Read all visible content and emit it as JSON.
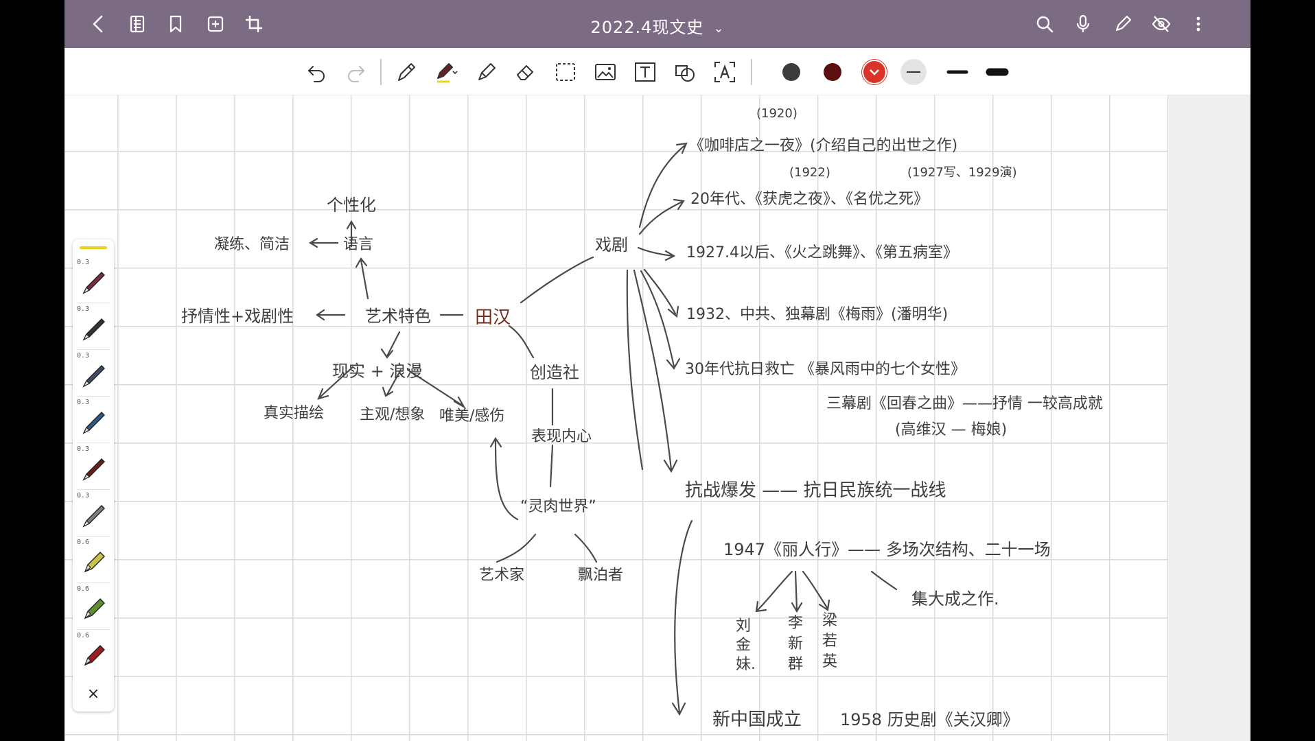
{
  "header": {
    "title": "2022.4现文史",
    "title_chevron": "⌄",
    "left_icons": [
      "back-icon",
      "pages-icon",
      "bookmark-icon",
      "add-page-icon",
      "crop-icon"
    ],
    "right_icons": [
      "search-icon",
      "microphone-icon",
      "pencil-icon",
      "hide-icon",
      "more-icon"
    ],
    "bar_color": "#7b6c84"
  },
  "toolbar": {
    "tools": [
      "undo-icon",
      "redo-icon",
      "pen-icon",
      "pen-active-icon",
      "highlighter-icon",
      "eraser-icon",
      "lasso-select-icon",
      "image-icon",
      "text-icon",
      "shape-icon",
      "text-recognition-icon"
    ],
    "colors": [
      "#3b3b3b",
      "#5c0f0f",
      "#d9332a"
    ],
    "line_widths": [
      "thin",
      "medium",
      "thick"
    ]
  },
  "pen_panel": {
    "pens": [
      {
        "size": "0.3",
        "color": "#7a2d3a",
        "kind": "pen"
      },
      {
        "size": "0.3",
        "color": "#333333",
        "kind": "pen"
      },
      {
        "size": "0.3",
        "color": "#3d4d6b",
        "kind": "pen"
      },
      {
        "size": "0.3",
        "color": "#2e5a86",
        "kind": "pen"
      },
      {
        "size": "0.3",
        "color": "#6a1f1f",
        "kind": "pen"
      },
      {
        "size": "0.3",
        "color": "#7d7d7d",
        "kind": "pen"
      },
      {
        "size": "0.6",
        "color": "#c9c24c",
        "kind": "marker"
      },
      {
        "size": "0.6",
        "color": "#5f8f2f",
        "kind": "marker"
      },
      {
        "size": "0.6",
        "color": "#9a1f22",
        "kind": "marker"
      }
    ],
    "close_label": "×",
    "active_indicator_color": "#f1d21b"
  },
  "notes": {
    "center": "田汉",
    "drama": "戏剧",
    "art_features": "艺术特色",
    "language": "语言",
    "individual": "个性化",
    "concise": "凝练、简洁",
    "lyric": "抒情性+戏剧性",
    "real_romantic": "现实 + 浪漫",
    "real_depict": "真实描绘",
    "subjective": "主观/想象",
    "aesthetic": "唯美/感伤",
    "creation_society": "创造社",
    "express_inner": "表现内心",
    "soul_world": "“灵肉世界”",
    "artist": "艺术家",
    "wanderer": "飘泊者",
    "year1920": "(1920)",
    "cafe": "《咖啡店之一夜》(介绍自己的出世之作)",
    "year1922": "(1922)",
    "year1927": "(1927写、1929演)",
    "tiger": "20年代、《获虎之夜》、《名优之死》",
    "fire": "1927.4以后、《火之跳舞》、《第五病室》",
    "plum": "1932、中共、独幕剧《梅雨》(潘明华)",
    "storm": "30年代抗日救亡  《暴风雨中的七个女性》",
    "return_song": "三幕剧《回春之曲》——抒情 一较高成就",
    "gao": "(高维汉 — 梅娘)",
    "war": "抗战爆发 —— 抗日民族统一战线",
    "beauty": "1947《丽人行》—— 多场次结构、二十一场",
    "masterpiece": "集大成之作.",
    "char1": "刘金妹.",
    "char2": "李新群",
    "char3": "梁若英",
    "new_china": "新中国成立",
    "guan": "1958 历史剧《关汉卿》"
  }
}
